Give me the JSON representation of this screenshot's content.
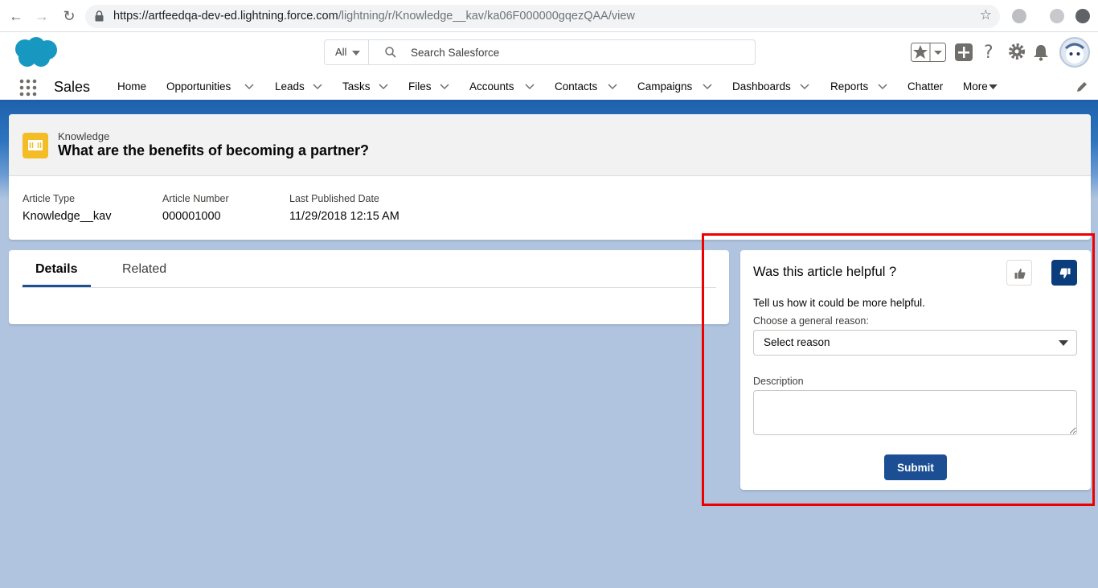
{
  "browser": {
    "url_host": "https://artfeedqa-dev-ed.lightning.force.com",
    "url_path": "/lightning/r/Knowledge__kav/ka06F000000gqezQAA/view"
  },
  "header": {
    "scope_label": "All",
    "search_placeholder": "Search Salesforce"
  },
  "app": {
    "name": "Sales",
    "nav": [
      {
        "label": "Home",
        "dropdown": false
      },
      {
        "label": "Opportunities",
        "dropdown": true
      },
      {
        "label": "Leads",
        "dropdown": true
      },
      {
        "label": "Tasks",
        "dropdown": true
      },
      {
        "label": "Files",
        "dropdown": true
      },
      {
        "label": "Accounts",
        "dropdown": true
      },
      {
        "label": "Contacts",
        "dropdown": true
      },
      {
        "label": "Campaigns",
        "dropdown": true
      },
      {
        "label": "Dashboards",
        "dropdown": true
      },
      {
        "label": "Reports",
        "dropdown": true
      },
      {
        "label": "Chatter",
        "dropdown": false
      },
      {
        "label": "More",
        "dropdown": true
      }
    ]
  },
  "record": {
    "object_label": "Knowledge",
    "title": "What are the benefits of becoming a partner?",
    "fields": [
      {
        "label": "Article Type",
        "value": "Knowledge__kav"
      },
      {
        "label": "Article Number",
        "value": "000001000"
      },
      {
        "label": "Last Published Date",
        "value": "11/29/2018 12:15 AM"
      }
    ]
  },
  "tabs": [
    {
      "label": "Details",
      "active": true
    },
    {
      "label": "Related",
      "active": false
    }
  ],
  "feedback": {
    "title": "Was this article helpful ?",
    "subtitle": "Tell us how it could be more helpful.",
    "reason_label": "Choose a general reason:",
    "reason_value": "Select reason",
    "description_label": "Description",
    "submit_label": "Submit",
    "thumbs_down_selected": true
  },
  "colors": {
    "brand_blue": "#1b5297",
    "highlight_red": "#ee0000",
    "knowledge_icon": "#f4bc25"
  }
}
